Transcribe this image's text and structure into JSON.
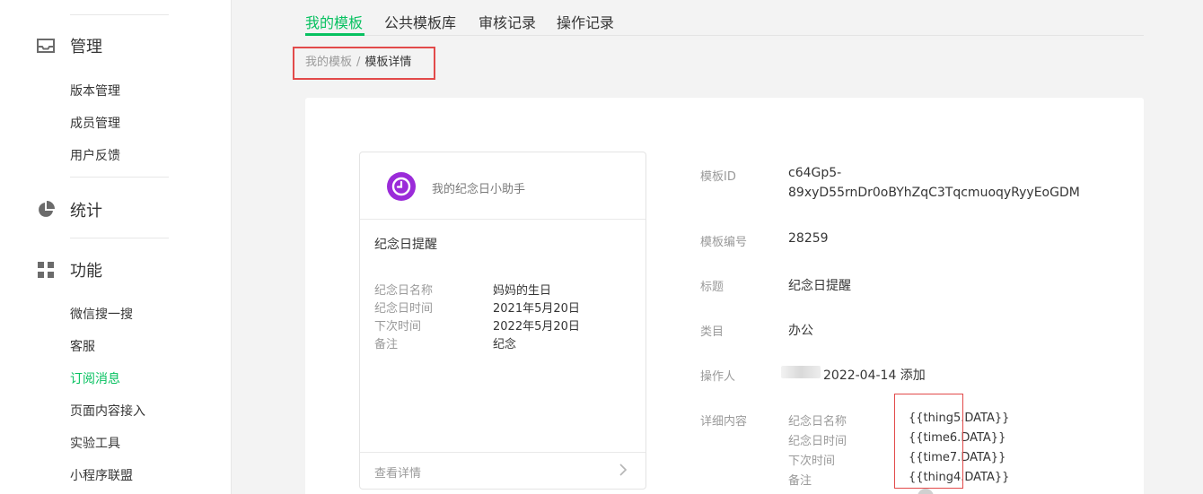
{
  "sidebar": {
    "groups": [
      {
        "label": "管理",
        "icon": "inbox-icon"
      },
      {
        "label": "统计",
        "icon": "pie-chart-icon"
      },
      {
        "label": "功能",
        "icon": "grid-icon"
      }
    ],
    "manage_items": [
      "版本管理",
      "成员管理",
      "用户反馈"
    ],
    "feature_items": [
      "微信搜一搜",
      "客服",
      "订阅消息",
      "页面内容接入",
      "实验工具",
      "小程序联盟"
    ],
    "active_item": "订阅消息"
  },
  "tabs": [
    "我的模板",
    "公共模板库",
    "审核记录",
    "操作记录"
  ],
  "breadcrumb": {
    "parent": "我的模板",
    "separator": "/",
    "current": "模板详情"
  },
  "preview": {
    "app_name": "我的纪念日小助手",
    "title": "纪念日提醒",
    "fields": [
      {
        "label": "纪念日名称",
        "value": "妈妈的生日"
      },
      {
        "label": "纪念日时间",
        "value": "2021年5月20日"
      },
      {
        "label": "下次时间",
        "value": "2022年5月20日"
      },
      {
        "label": "备注",
        "value": "纪念"
      }
    ],
    "footer_link": "查看详情"
  },
  "details": {
    "id_label": "模板ID",
    "id_line1": "c64Gp5-",
    "id_line2": "89xyD55rnDr0oBYhZqC3TqcmuoqyRyyEoGDM",
    "number_label": "模板编号",
    "number": "28259",
    "title_label": "标题",
    "title": "纪念日提醒",
    "category_label": "类目",
    "category": "办公",
    "operator_label": "操作人",
    "operator_action": "2022-04-14 添加",
    "content_label": "详细内容",
    "content": [
      {
        "label": "纪念日名称",
        "value": "{{thing5.DATA}}"
      },
      {
        "label": "纪念日时间",
        "value": "{{time6.DATA}}"
      },
      {
        "label": "下次时间",
        "value": "{{time7.DATA}}"
      },
      {
        "label": "备注",
        "value": "{{thing4.DATA}}"
      }
    ]
  },
  "colors": {
    "accent": "#07c160",
    "annotation": "#e24a4a",
    "app_avatar": "#9b2bd9"
  }
}
